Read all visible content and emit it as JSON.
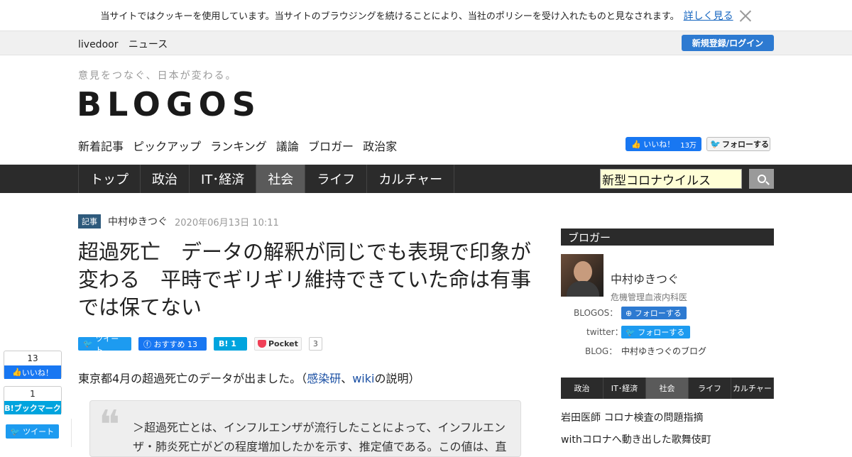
{
  "cookie": {
    "text": "当サイトではクッキーを使用しています。当サイトのブラウジングを続けることにより、当社のポリシーを受け入れたものと見なされます。",
    "link": "詳しく見る"
  },
  "livedoor": {
    "brand1": "livedoor",
    "brand2": "ニュース",
    "login": "新規登録/ログイン"
  },
  "header": {
    "tagline": "意見をつなぐ、日本が変わる。",
    "logo": "BLOGOS",
    "subnav": [
      "新着記事",
      "ピックアップ",
      "ランキング",
      "議論",
      "ブロガー",
      "政治家"
    ],
    "like_label": "いいね！",
    "like_count": "13万",
    "follow_label": "フォローする"
  },
  "mainnav": {
    "items": [
      "トップ",
      "政治",
      "IT･経済",
      "社会",
      "ライフ",
      "カルチャー"
    ],
    "active": "社会",
    "search_value": "新型コロナウイルス"
  },
  "article": {
    "badge": "記事",
    "author": "中村ゆきつぐ",
    "date": "2020年06月13日 10:11",
    "title": "超過死亡　データの解釈が同じでも表現で印象が変わる　平時でギリギリ維持できていた命は有事では保てない",
    "share": {
      "tweet": "ツイート",
      "fb": "おすすめ 13",
      "hatena": "B! 1",
      "pocket": "Pocket",
      "pocket_count": "3"
    },
    "body_prefix": "東京都4月の超過死亡のデータが出ました。（",
    "link1": "感染研",
    "sep": "、",
    "link2": "wiki",
    "body_suffix": "の説明）",
    "quote": "＞超過死亡とは、インフルエンザが流行したことによって、インフルエンザ・肺炎死亡がどの程度増加したかを示す、推定値である。この値は、直"
  },
  "floating": {
    "like_count": "13",
    "like_label": "いいね！",
    "hb_count": "1",
    "hb_label": "B!ブックマーク",
    "tweet": "ツイート"
  },
  "sidebar": {
    "heading": "ブロガー",
    "name": "中村ゆきつぐ",
    "role": "危機管理血液内科医",
    "blogos_label": "BLOGOS：",
    "blogos_follow": "フォローする",
    "twitter_label": "twitter：",
    "twitter_follow": "フォローする",
    "blog_label": "BLOG：",
    "blog_link": "中村ゆきつぐのブログ",
    "tabs": [
      "政治",
      "IT･経済",
      "社会",
      "ライフ",
      "カルチャー"
    ],
    "active_tab": "社会",
    "news": [
      "岩田医師 コロナ検査の問題指摘",
      "withコロナへ動き出した歌舞伎町"
    ]
  }
}
